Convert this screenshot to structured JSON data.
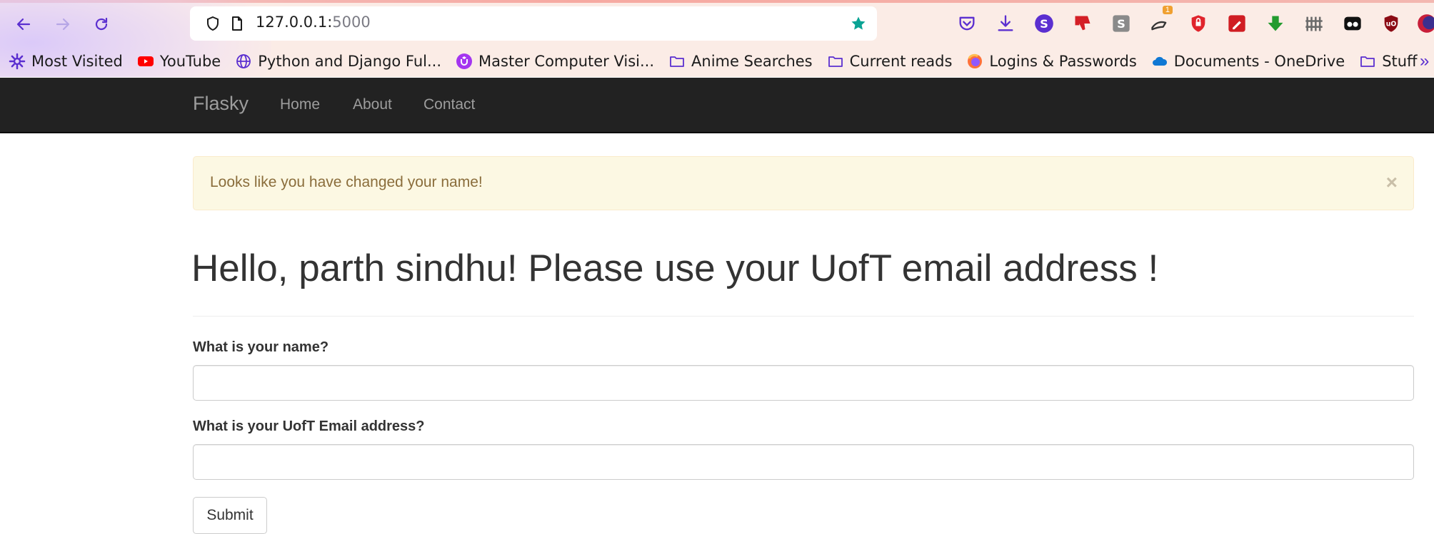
{
  "browser": {
    "url_host": "127.0.0.1:",
    "url_port": "5000",
    "bookmarks": [
      {
        "label": "Most Visited",
        "icon": "gear-icon"
      },
      {
        "label": "YouTube",
        "icon": "youtube-icon"
      },
      {
        "label": "Python and Django Ful...",
        "icon": "globe-icon"
      },
      {
        "label": "Master Computer Visi...",
        "icon": "udemy-icon"
      },
      {
        "label": "Anime Searches",
        "icon": "folder-icon"
      },
      {
        "label": "Current reads",
        "icon": "folder-icon"
      },
      {
        "label": "Logins & Passwords",
        "icon": "firefox-icon"
      },
      {
        "label": "Documents - OneDrive",
        "icon": "onedrive-icon"
      },
      {
        "label": "Stuff",
        "icon": "folder-icon"
      }
    ],
    "extension_badge": "1",
    "colors": {
      "accent": "#5b2fd0",
      "star": "#0aa394"
    }
  },
  "navbar": {
    "brand": "Flasky",
    "links": [
      "Home",
      "About",
      "Contact"
    ]
  },
  "alert": {
    "message": "Looks like you have changed your name!",
    "close": "×"
  },
  "heading": "Hello, parth sindhu! Please use your UofT email address !",
  "form": {
    "name_label": "What is your name?",
    "name_value": "",
    "email_label": "What is your UofT Email address?",
    "email_value": "",
    "submit_label": "Submit"
  }
}
